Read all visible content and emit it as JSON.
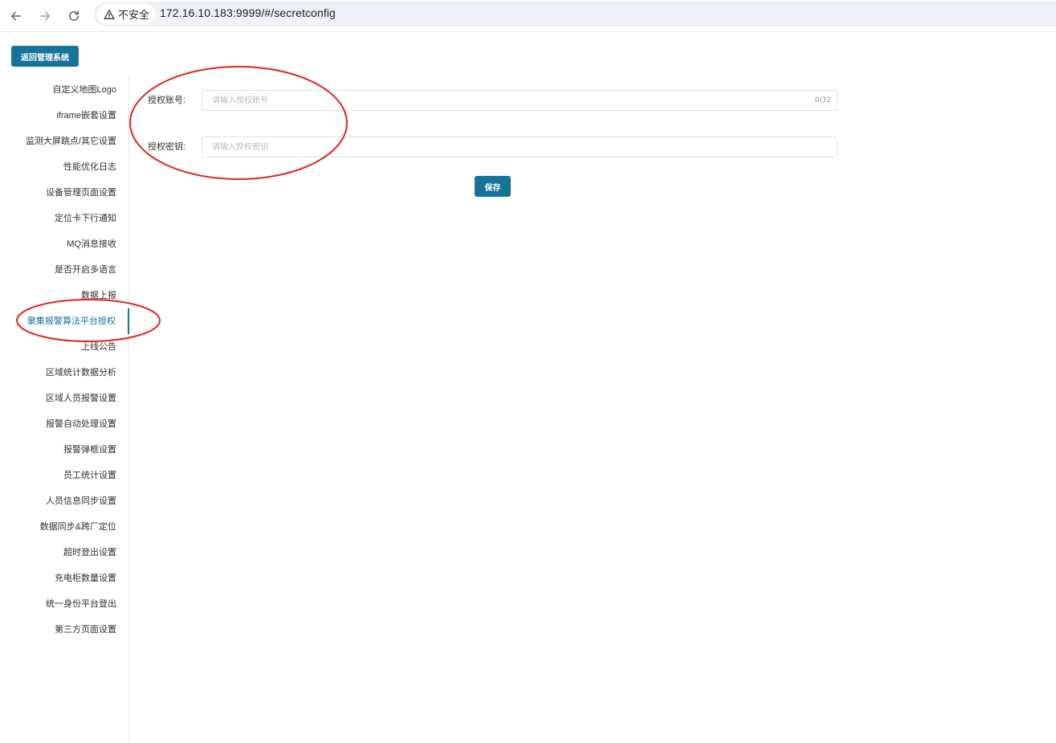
{
  "browser": {
    "back_icon": "arrow-left-icon",
    "forward_icon": "arrow-right-icon",
    "reload_icon": "reload-icon",
    "security_label": "不安全",
    "url": "172.16.10.183:9999/#/secretconfig"
  },
  "header": {
    "back_button_label": "返回管理系统"
  },
  "sidebar": {
    "active_index": 9,
    "items": [
      {
        "label": "自定义地图Logo"
      },
      {
        "label": "iframe嵌套设置"
      },
      {
        "label": "监测大屏跳点/其它设置"
      },
      {
        "label": "性能优化日志"
      },
      {
        "label": "设备管理页面设置"
      },
      {
        "label": "定位卡下行通知"
      },
      {
        "label": "MQ消息接收"
      },
      {
        "label": "是否开启多语言"
      },
      {
        "label": "数据上报"
      },
      {
        "label": "聚集报警算法平台授权"
      },
      {
        "label": "上线公告"
      },
      {
        "label": "区域统计数据分析"
      },
      {
        "label": "区域人员报警设置"
      },
      {
        "label": "报警自动处理设置"
      },
      {
        "label": "报警弹框设置"
      },
      {
        "label": "员工统计设置"
      },
      {
        "label": "人员信息同步设置"
      },
      {
        "label": "数据同步&跨厂定位"
      },
      {
        "label": "超时登出设置"
      },
      {
        "label": "充电柜数量设置"
      },
      {
        "label": "统一身份平台登出"
      },
      {
        "label": "第三方页面设置"
      }
    ]
  },
  "form": {
    "account": {
      "label": "授权账号:",
      "placeholder": "请输入授权账号",
      "value": "",
      "counter": "0/32"
    },
    "secret": {
      "label": "授权密钥:",
      "placeholder": "请输入授权密钥",
      "value": ""
    },
    "save_label": "保存"
  },
  "colors": {
    "primary": "#16749a",
    "annotation": "#e0251f"
  }
}
